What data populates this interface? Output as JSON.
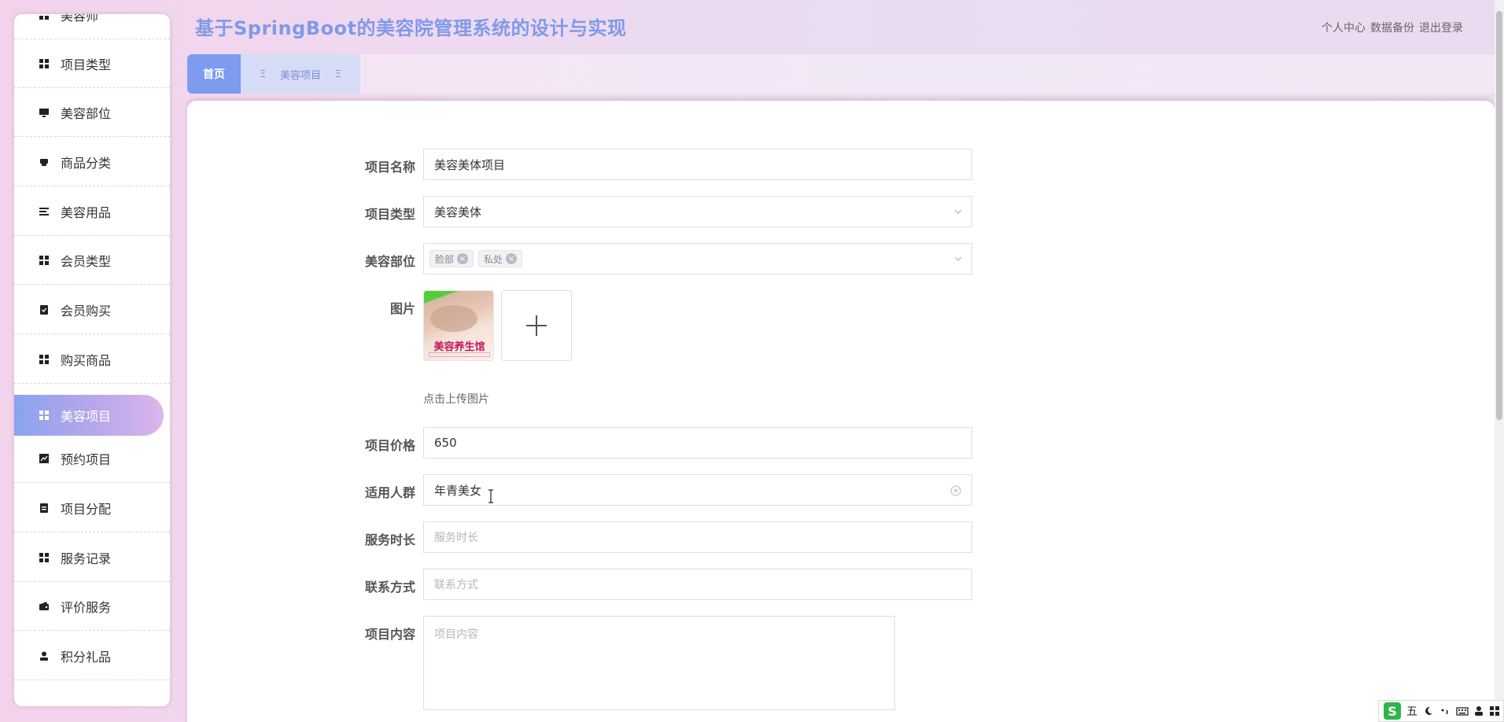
{
  "app": {
    "title": "基于SpringBoot的美容院管理系统的设计与实现"
  },
  "top_links": {
    "profile": "个人中心",
    "backup": "数据备份",
    "logout": "退出登录"
  },
  "sidebar": {
    "items": [
      {
        "label": "美容师",
        "icon": "grid-icon"
      },
      {
        "label": "项目类型",
        "icon": "grid-icon"
      },
      {
        "label": "美容部位",
        "icon": "monitor-icon"
      },
      {
        "label": "商品分类",
        "icon": "printer-icon"
      },
      {
        "label": "美容用品",
        "icon": "list-icon"
      },
      {
        "label": "会员类型",
        "icon": "grid-icon"
      },
      {
        "label": "会员购买",
        "icon": "clipboard-check-icon"
      },
      {
        "label": "购买商品",
        "icon": "grid-icon"
      },
      {
        "label": "美容项目",
        "icon": "grid-icon",
        "active": true
      },
      {
        "label": "预约项目",
        "icon": "chart-icon"
      },
      {
        "label": "项目分配",
        "icon": "clipboard-icon"
      },
      {
        "label": "服务记录",
        "icon": "grid-icon"
      },
      {
        "label": "评价服务",
        "icon": "wallet-icon"
      },
      {
        "label": "积分礼品",
        "icon": "user-icon"
      }
    ]
  },
  "tabs": {
    "home": "首页",
    "current": "美容项目",
    "glyph": "Ξ"
  },
  "form": {
    "name": {
      "label": "项目名称",
      "value": "美容美体项目"
    },
    "type": {
      "label": "项目类型",
      "value": "美容美体"
    },
    "part": {
      "label": "美容部位",
      "tags": [
        "脸部",
        "私处"
      ]
    },
    "image": {
      "label": "图片",
      "thumb_text": "美容养生馆",
      "upload_hint": "点击上传图片"
    },
    "price": {
      "label": "项目价格",
      "value": "650"
    },
    "crowd": {
      "label": "适用人群",
      "value": "年青美女"
    },
    "duration": {
      "label": "服务时长",
      "placeholder": "服务时长"
    },
    "contact": {
      "label": "联系方式",
      "placeholder": "联系方式"
    },
    "content": {
      "label": "项目内容",
      "placeholder": "项目内容"
    }
  },
  "ime": {
    "logo": "S",
    "mode": "五"
  },
  "colors": {
    "accent": "#7d9bef",
    "title": "#7f9ae8"
  }
}
